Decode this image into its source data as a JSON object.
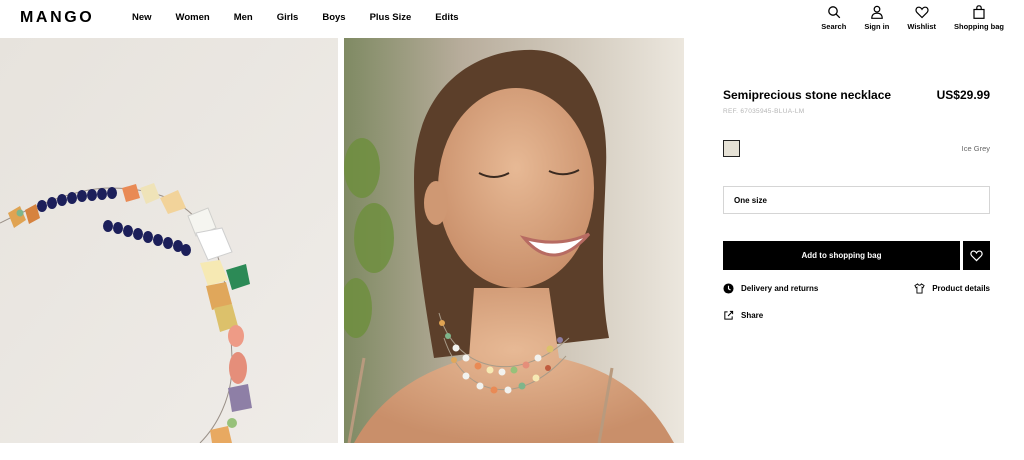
{
  "brand": {
    "logo": "MANGO"
  },
  "nav": {
    "items": [
      {
        "label": "New"
      },
      {
        "label": "Women"
      },
      {
        "label": "Men"
      },
      {
        "label": "Girls"
      },
      {
        "label": "Boys"
      },
      {
        "label": "Plus Size"
      },
      {
        "label": "Edits"
      }
    ]
  },
  "tools": {
    "search": {
      "label": "Search",
      "icon": "search-icon"
    },
    "signin": {
      "label": "Sign in",
      "icon": "user-icon"
    },
    "wishlist": {
      "label": "Wishlist",
      "icon": "heart-icon"
    },
    "bag": {
      "label": "Shopping bag",
      "icon": "bag-icon"
    }
  },
  "product": {
    "name": "Semiprecious stone necklace",
    "price": "US$29.99",
    "ref": "REF. 67035945-BLUA-LM",
    "color": {
      "name": "Ice Grey",
      "swatch": "#e6e2d6"
    },
    "size": "One size",
    "add_label": "Add to shopping bag",
    "delivery_label": "Delivery and returns",
    "details_label": "Product details",
    "share_label": "Share"
  }
}
